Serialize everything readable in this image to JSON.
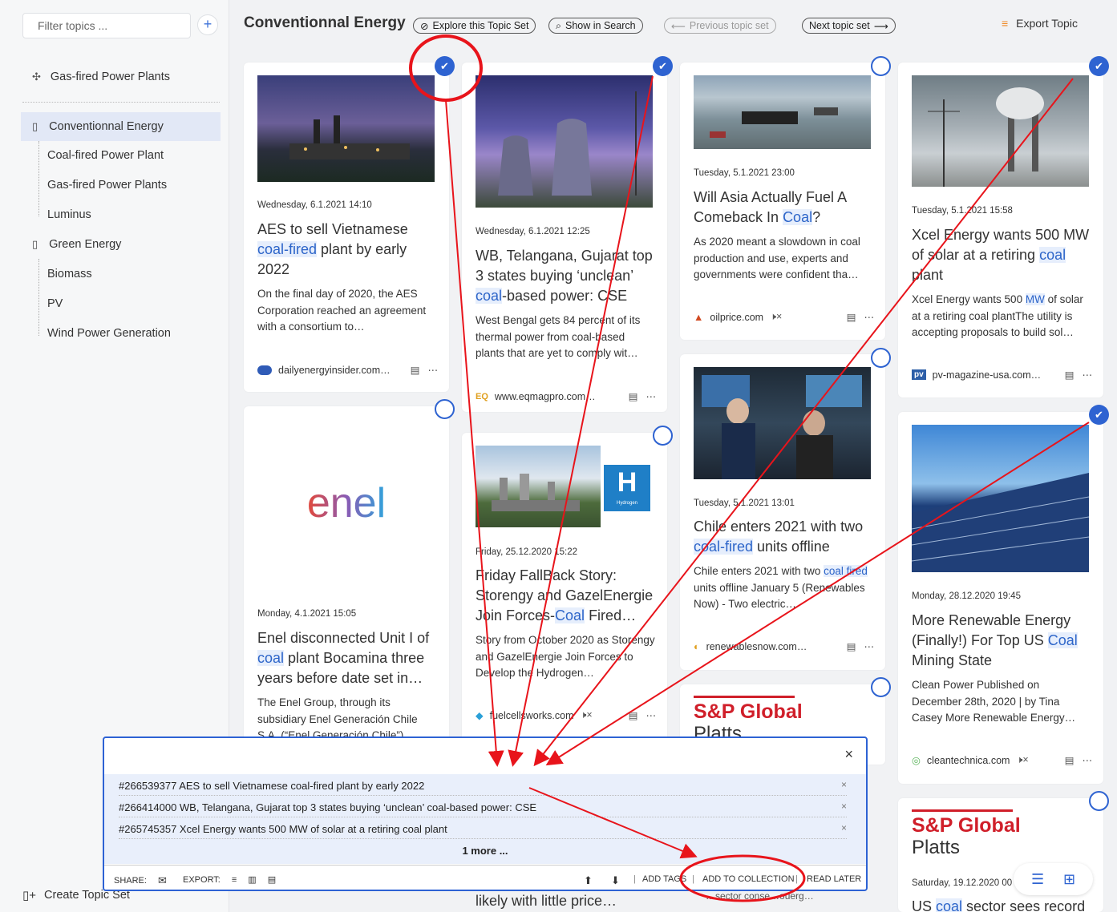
{
  "sidebar": {
    "filter_placeholder": "Filter topics ...",
    "add_label": "+",
    "pinned_label": "Gas-fired Power Plants",
    "groups": [
      {
        "label": "Conventionnal Energy",
        "children": [
          "Coal-fired Power Plant",
          "Gas-fired Power Plants",
          "Luminus"
        ]
      },
      {
        "label": "Green Energy",
        "children": [
          "Biomass",
          "PV",
          "Wind Power Generation"
        ]
      }
    ],
    "create_label": "Create Topic Set"
  },
  "header": {
    "title": "Conventionnal Energy",
    "explore_label": "Explore this Topic Set",
    "show_search_label": "Show in Search",
    "prev_label": "Previous topic set",
    "next_label": "Next topic set",
    "export_label": "Export Topic"
  },
  "cards": [
    {
      "date": "Wednesday, 6.1.2021 14:10",
      "title_pre": "AES to sell Vietnamese ",
      "title_hl": "coal-fired",
      "title_post": " plant by early 2022",
      "snippet": "On the final day of 2020, the AES Corporation reached an agreement with a consortium to…",
      "source": "dailyenergyinsider.com…"
    },
    {
      "date": "Monday, 4.1.2021 15:05",
      "title_pre": "Enel disconnected Unit I of ",
      "title_hl": "coal",
      "title_post": " plant Bocamina three years before date set in…",
      "snippet": "The Enel Group, through its subsidiary Enel Generación Chile S.A. (“Enel Generación Chile”),",
      "logo": "enel"
    },
    {
      "date": "Wednesday, 6.1.2021 12:25",
      "title_pre": "WB, Telangana, Gujarat top 3 states buying ‘unclean’ ",
      "title_hl": "coal",
      "title_post": "-based power: CSE",
      "snippet": "West Bengal gets 84 percent of its thermal power from coal-based plants that are yet to comply wit…",
      "source": "www.eqmagpro.com…"
    },
    {
      "date": "Friday, 25.12.2020 15:22",
      "title_pre": "Friday FallBack Story: Storengy and GazelEnergie Join Forces-",
      "title_hl": "Coal",
      "title_post": " Fired…",
      "snippet": "Story from October 2020 as Storengy and GazelEnergie Join Forces to Develop the Hydrogen…",
      "source": "fuelcellsworks.com",
      "badge": "H",
      "badge_sub": "Hydrogen"
    },
    {
      "date": "Tuesday, 5.1.2021 23:00",
      "title_pre": "Will Asia Actually Fuel A Comeback In ",
      "title_hl": "Coal",
      "title_post": "?",
      "snippet": "As 2020 meant a slowdown in coal production and use, experts and governments were confident tha…",
      "source": "oilprice.com"
    },
    {
      "date": "Tuesday, 5.1.2021 13:01",
      "title_pre": "Chile enters 2021 with two ",
      "title_hl": "coal-fired",
      "title_post": " units offline",
      "snippet_pre": "Chile enters 2021 with two ",
      "snippet_hl": "coal fired",
      "snippet_post": " units offline January 5 (Renewables Now) - Two electric…",
      "source": "renewablesnow.com…"
    },
    {
      "logo_line1": "S&P Global",
      "logo_line2": "Platts"
    },
    {
      "date": "Tuesday, 5.1.2021 15:58",
      "title_pre": "Xcel Energy wants 500 MW of solar at a retiring ",
      "title_hl": "coal",
      "title_post": " plant",
      "snippet_pre": "Xcel Energy wants 500 ",
      "snippet_hl": "MW",
      "snippet_post": " of solar at a retiring coal plantThe utility is accepting proposals to build sol…",
      "source": "pv-magazine-usa.com…",
      "source_icon": "pv"
    },
    {
      "date": "Monday, 28.12.2020 19:45",
      "title_pre": "More Renewable Energy (Finally!) For Top US ",
      "title_hl": "Coal",
      "title_post": " Mining State",
      "snippet": "Clean Power Published on December 28th, 2020 | by Tina Casey More Renewable Energy…",
      "source": "cleantechnica.com"
    },
    {
      "logo_line1": "S&P Global",
      "logo_line2": "Platts",
      "date": "Saturday, 19.12.2020 00",
      "title_pre": "US ",
      "title_hl": "coal",
      "title_post": " sector sees record"
    }
  ],
  "partial_text": {
    "likely": "likely with little price…",
    "sector_fragment": "…sector conse…ouerg…"
  },
  "panel": {
    "close": "×",
    "rows": [
      "#266539377 AES to sell Vietnamese coal-fired plant by early 2022",
      "#266414000 WB, Telangana, Gujarat top 3 states buying ‘unclean’ coal-based power: CSE",
      "#265745357 Xcel Energy wants 500 MW of solar at a retiring coal plant"
    ],
    "row_remove": "×",
    "more": "1 more ...",
    "share_label": "SHARE:",
    "export_label": "EXPORT:",
    "add_tags": "ADD TAGS",
    "add_collection": "ADD TO COLLECTION",
    "read_later": "READ LATER"
  },
  "colors": {
    "accent": "#2e63d1",
    "highlight_bg": "#e6eefc",
    "annotation": "#e8141b"
  }
}
